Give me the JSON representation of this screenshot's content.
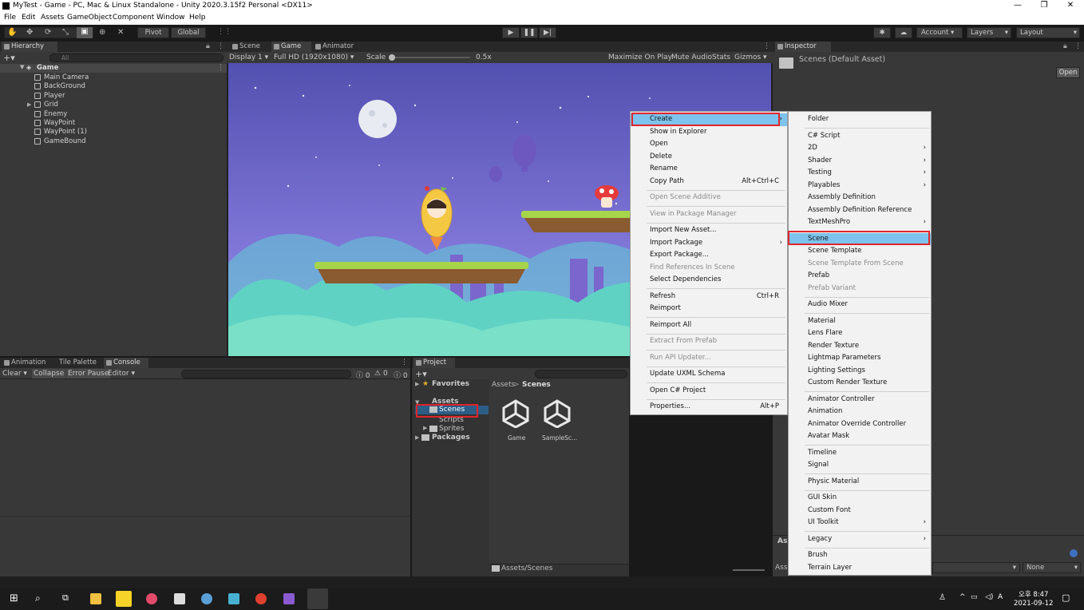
{
  "window": {
    "title": "MyTest - Game - PC, Mac & Linux Standalone - Unity 2020.3.15f2 Personal <DX11>",
    "min": "—",
    "max": "❐",
    "close": "✕"
  },
  "menubar": [
    "File",
    "Edit",
    "Assets",
    "GameObject",
    "Component",
    "Window",
    "Help"
  ],
  "toolbar": {
    "pivot": "Pivot",
    "global": "Global",
    "account": "Account",
    "layers": "Layers",
    "layout": "Layout"
  },
  "hierarchy": {
    "tab": "Hierarchy",
    "search_placeholder": "All",
    "root": "Game",
    "items": [
      "Main Camera",
      "BackGround",
      "Player",
      "Grid",
      "Enemy",
      "WayPoint",
      "WayPoint (1)",
      "GameBound"
    ]
  },
  "center_tabs": [
    "Scene",
    "Game",
    "Animator"
  ],
  "game_bar": {
    "display": "Display 1",
    "resolution": "Full HD (1920x1080)",
    "scale_label": "Scale",
    "scale_value": "0.5x",
    "maximize": "Maximize On Play",
    "mute": "Mute Audio",
    "stats": "Stats",
    "gizmos": "Gizmos"
  },
  "inspector": {
    "tab": "Inspector",
    "title": "Scenes (Default Asset)",
    "open": "Open",
    "bottom_label1": "Ass",
    "bottom_label2": "Asse",
    "none": "None"
  },
  "bottom_tabs": [
    "Animation",
    "Tile Palette",
    "Console"
  ],
  "console_bar": {
    "clear": "Clear",
    "collapse": "Collapse",
    "error_pause": "Error Pause",
    "editor": "Editor",
    "c1": "0",
    "c2": "0",
    "c3": "0"
  },
  "project": {
    "tab": "Project",
    "favorites": "Favorites",
    "assets": "Assets",
    "folders": [
      "Scenes",
      "Scripts",
      "Sprites"
    ],
    "packages": "Packages",
    "breadcrumb_root": "Assets",
    "breadcrumb_sep": ">",
    "breadcrumb_cur": "Scenes",
    "files": [
      "Game",
      "SampleSc..."
    ],
    "footer_path": "Assets/Scenes"
  },
  "context_menu": [
    {
      "label": "Create",
      "arrow": "›",
      "highlight": true
    },
    {
      "label": "Show in Explorer"
    },
    {
      "label": "Open"
    },
    {
      "label": "Delete"
    },
    {
      "label": "Rename"
    },
    {
      "label": "Copy Path",
      "shortcut": "Alt+Ctrl+C"
    },
    {
      "sep": true
    },
    {
      "label": "Open Scene Additive",
      "disabled": true
    },
    {
      "sep": true
    },
    {
      "label": "View in Package Manager",
      "disabled": true
    },
    {
      "sep": true
    },
    {
      "label": "Import New Asset..."
    },
    {
      "label": "Import Package",
      "arrow": "›"
    },
    {
      "label": "Export Package..."
    },
    {
      "label": "Find References In Scene",
      "disabled": true
    },
    {
      "label": "Select Dependencies"
    },
    {
      "sep": true
    },
    {
      "label": "Refresh",
      "shortcut": "Ctrl+R"
    },
    {
      "label": "Reimport"
    },
    {
      "sep": true
    },
    {
      "label": "Reimport All"
    },
    {
      "sep": true
    },
    {
      "label": "Extract From Prefab",
      "disabled": true
    },
    {
      "sep": true
    },
    {
      "label": "Run API Updater...",
      "disabled": true
    },
    {
      "sep": true
    },
    {
      "label": "Update UXML Schema"
    },
    {
      "sep": true
    },
    {
      "label": "Open C# Project"
    },
    {
      "sep": true
    },
    {
      "label": "Properties...",
      "shortcut": "Alt+P"
    }
  ],
  "create_submenu": [
    {
      "label": "Folder"
    },
    {
      "sep": true
    },
    {
      "label": "C# Script"
    },
    {
      "label": "2D",
      "arrow": "›"
    },
    {
      "label": "Shader",
      "arrow": "›"
    },
    {
      "label": "Testing",
      "arrow": "›"
    },
    {
      "label": "Playables",
      "arrow": "›"
    },
    {
      "label": "Assembly Definition"
    },
    {
      "label": "Assembly Definition Reference"
    },
    {
      "label": "TextMeshPro",
      "arrow": "›"
    },
    {
      "sep": true
    },
    {
      "label": "Scene",
      "highlight": true
    },
    {
      "label": "Scene Template"
    },
    {
      "label": "Scene Template From Scene",
      "disabled": true
    },
    {
      "label": "Prefab"
    },
    {
      "label": "Prefab Variant",
      "disabled": true
    },
    {
      "sep": true
    },
    {
      "label": "Audio Mixer"
    },
    {
      "sep": true
    },
    {
      "label": "Material"
    },
    {
      "label": "Lens Flare"
    },
    {
      "label": "Render Texture"
    },
    {
      "label": "Lightmap Parameters"
    },
    {
      "label": "Lighting Settings"
    },
    {
      "label": "Custom Render Texture"
    },
    {
      "sep": true
    },
    {
      "label": "Animator Controller"
    },
    {
      "label": "Animation"
    },
    {
      "label": "Animator Override Controller"
    },
    {
      "label": "Avatar Mask"
    },
    {
      "sep": true
    },
    {
      "label": "Timeline"
    },
    {
      "label": "Signal"
    },
    {
      "sep": true
    },
    {
      "label": "Physic Material"
    },
    {
      "sep": true
    },
    {
      "label": "GUI Skin"
    },
    {
      "label": "Custom Font"
    },
    {
      "label": "UI Toolkit",
      "arrow": "›"
    },
    {
      "sep": true
    },
    {
      "label": "Legacy",
      "arrow": "›"
    },
    {
      "sep": true
    },
    {
      "label": "Brush"
    },
    {
      "label": "Terrain Layer"
    }
  ],
  "taskbar": {
    "time": "오후 8:47",
    "date": "2021-09-12",
    "lang": "A"
  },
  "colors": {
    "accent_highlight": "#7dc3ed",
    "annotation_red": "#e0242c",
    "sky_top": "#5a5ab8",
    "sky_bottom": "#8f86e0"
  }
}
